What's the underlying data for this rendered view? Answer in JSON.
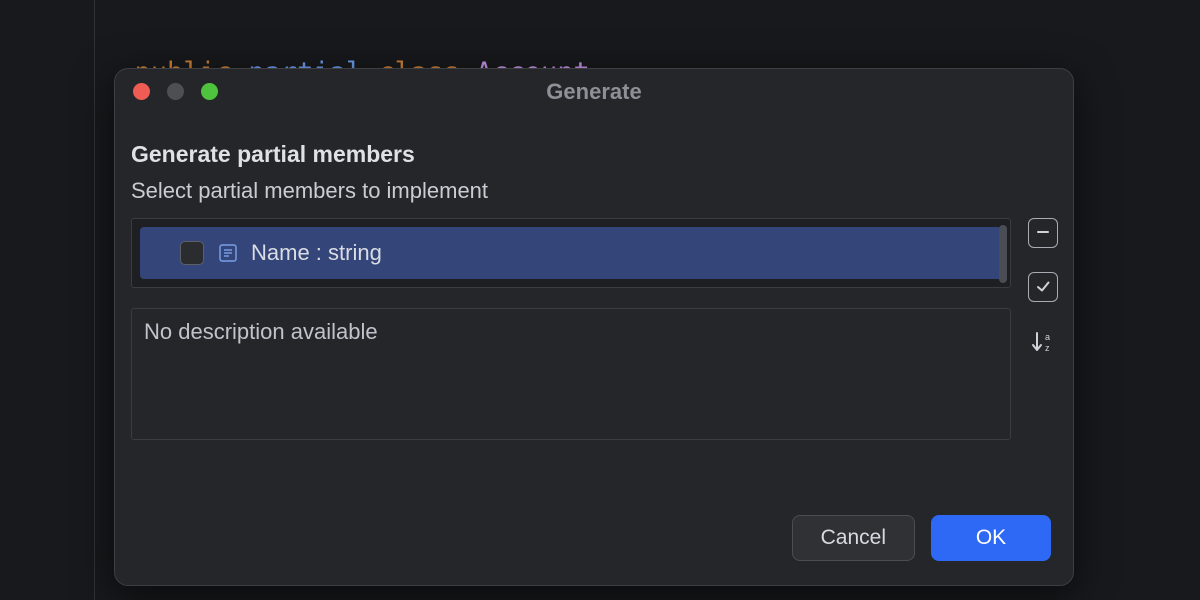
{
  "editor": {
    "tokens": {
      "kw_public": "public",
      "kw_partial": "partial",
      "kw_class": "class",
      "class_name": "Account"
    }
  },
  "dialog": {
    "title": "Generate",
    "heading": "Generate partial members",
    "sub_heading": "Select partial members to implement",
    "members": [
      {
        "label": "Name : string",
        "checked": false
      }
    ],
    "description_placeholder": "No description available",
    "buttons": {
      "cancel": "Cancel",
      "ok": "OK"
    },
    "side_controls": {
      "deselect_all": "deselect-all",
      "select_all": "select-all",
      "sort_alpha": "sort-alphabetically"
    }
  }
}
